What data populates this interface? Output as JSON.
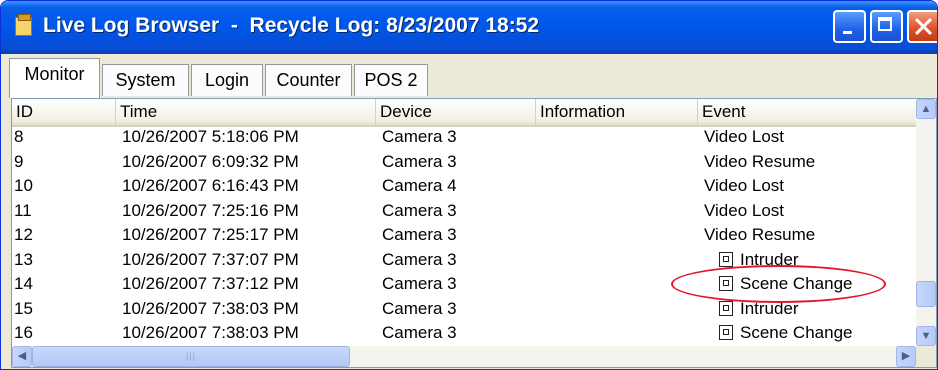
{
  "window": {
    "title": "Live Log Browser  -  Recycle Log: 8/23/2007 18:52"
  },
  "tabs": [
    {
      "label": "Monitor",
      "active": true
    },
    {
      "label": "System",
      "active": false
    },
    {
      "label": "Login",
      "active": false
    },
    {
      "label": "Counter",
      "active": false
    },
    {
      "label": "POS 2",
      "active": false
    }
  ],
  "table": {
    "columns": [
      "ID",
      "Time",
      "Device",
      "Information",
      "Event"
    ],
    "rows": [
      {
        "id": "8",
        "time": "10/26/2007 5:18:06 PM",
        "device": "Camera 3",
        "info": "",
        "event": "Video Lost"
      },
      {
        "id": "9",
        "time": "10/26/2007 6:09:32 PM",
        "device": "Camera 3",
        "info": "",
        "event": "Video Resume"
      },
      {
        "id": "10",
        "time": "10/26/2007 6:16:43 PM",
        "device": "Camera 4",
        "info": "",
        "event": "Video Lost"
      },
      {
        "id": "11",
        "time": "10/26/2007 7:25:16 PM",
        "device": "Camera 3",
        "info": "",
        "event": "Video Lost"
      },
      {
        "id": "12",
        "time": "10/26/2007 7:25:17 PM",
        "device": "Camera 3",
        "info": "",
        "event": "Video Resume"
      },
      {
        "id": "13",
        "time": "10/26/2007 7:37:07 PM",
        "device": "Camera 3",
        "info": "",
        "event": "Intruder"
      },
      {
        "id": "14",
        "time": "10/26/2007 7:37:12 PM",
        "device": "Camera 3",
        "info": "",
        "event": "Scene Change"
      },
      {
        "id": "15",
        "time": "10/26/2007 7:38:03 PM",
        "device": "Camera 3",
        "info": "",
        "event": "Intruder"
      },
      {
        "id": "16",
        "time": "10/26/2007 7:38:03 PM",
        "device": "Camera 3",
        "info": "",
        "event": "Scene Change"
      }
    ]
  },
  "icons": {
    "event_icon": "event-snapshot-icon",
    "app_icon": "clipboard-icon"
  },
  "colors": {
    "titlebar": "#0054e3",
    "annotation": "#e3142b"
  }
}
